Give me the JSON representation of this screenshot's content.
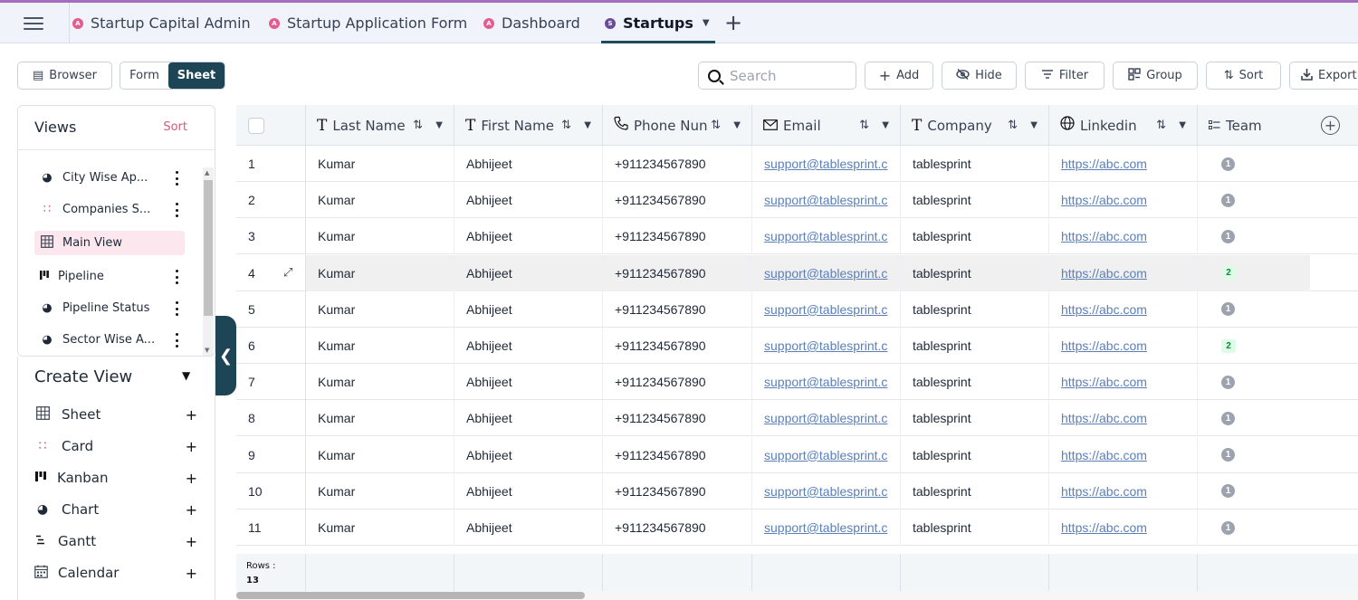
{
  "tabs": [
    {
      "label": "Startup Capital Admin",
      "badge": "A"
    },
    {
      "label": "Startup Application Form",
      "badge": "A"
    },
    {
      "label": "Dashboard",
      "badge": "A"
    },
    {
      "label": "Startups",
      "badge": "S",
      "active": true
    }
  ],
  "toolbar": {
    "browser_label": "Browser",
    "form_label": "Form",
    "sheet_label": "Sheet",
    "search_placeholder": "Search",
    "add_label": "Add",
    "hide_label": "Hide",
    "filter_label": "Filter",
    "group_label": "Group",
    "sort_label": "Sort",
    "export_label": "Export"
  },
  "views": {
    "title": "Views",
    "sort_label": "Sort",
    "items": [
      {
        "label": "City Wise Ap...",
        "icon": "pie-chart-icon"
      },
      {
        "label": "Companies S...",
        "icon": "card-grid-icon"
      },
      {
        "label": "Main View",
        "icon": "sheet-grid-icon",
        "selected": true
      },
      {
        "label": "Pipeline",
        "icon": "kanban-icon"
      },
      {
        "label": "Pipeline Status",
        "icon": "pie-chart-icon"
      },
      {
        "label": "Sector Wise A...",
        "icon": "pie-chart-icon"
      }
    ]
  },
  "create_view": {
    "title": "Create View",
    "items": [
      {
        "label": "Sheet",
        "icon": "sheet-grid-icon"
      },
      {
        "label": "Card",
        "icon": "card-grid-icon"
      },
      {
        "label": "Kanban",
        "icon": "kanban-icon"
      },
      {
        "label": "Chart",
        "icon": "pie-chart-icon"
      },
      {
        "label": "Gantt",
        "icon": "gantt-icon"
      },
      {
        "label": "Calendar",
        "icon": "calendar-icon"
      }
    ]
  },
  "table": {
    "columns": [
      "Last Name",
      "First Name",
      "Phone Nun",
      "Email",
      "Company",
      "Linkedin",
      "Team"
    ],
    "rows": [
      {
        "n": "1",
        "last": "Kumar",
        "first": "Abhijeet",
        "phone": "+911234567890",
        "email": "support@tablesprint.c",
        "company": "tablesprint",
        "linkedin": "https://abc.com",
        "team": "1"
      },
      {
        "n": "2",
        "last": "Kumar",
        "first": "Abhijeet",
        "phone": "+911234567890",
        "email": "support@tablesprint.c",
        "company": "tablesprint",
        "linkedin": "https://abc.com",
        "team": "1"
      },
      {
        "n": "3",
        "last": "Kumar",
        "first": "Abhijeet",
        "phone": "+911234567890",
        "email": "support@tablesprint.c",
        "company": "tablesprint",
        "linkedin": "https://abc.com",
        "team": "1"
      },
      {
        "n": "4",
        "last": "Kumar",
        "first": "Abhijeet",
        "phone": "+911234567890",
        "email": "support@tablesprint.c",
        "company": "tablesprint",
        "linkedin": "https://abc.com",
        "team": "2"
      },
      {
        "n": "5",
        "last": "Kumar",
        "first": "Abhijeet",
        "phone": "+911234567890",
        "email": "support@tablesprint.c",
        "company": "tablesprint",
        "linkedin": "https://abc.com",
        "team": "1"
      },
      {
        "n": "6",
        "last": "Kumar",
        "first": "Abhijeet",
        "phone": "+911234567890",
        "email": "support@tablesprint.c",
        "company": "tablesprint",
        "linkedin": "https://abc.com",
        "team": "2"
      },
      {
        "n": "7",
        "last": "Kumar",
        "first": "Abhijeet",
        "phone": "+911234567890",
        "email": "support@tablesprint.c",
        "company": "tablesprint",
        "linkedin": "https://abc.com",
        "team": "1"
      },
      {
        "n": "8",
        "last": "Kumar",
        "first": "Abhijeet",
        "phone": "+911234567890",
        "email": "support@tablesprint.c",
        "company": "tablesprint",
        "linkedin": "https://abc.com",
        "team": "1"
      },
      {
        "n": "9",
        "last": "Kumar",
        "first": "Abhijeet",
        "phone": "+911234567890",
        "email": "support@tablesprint.c",
        "company": "tablesprint",
        "linkedin": "https://abc.com",
        "team": "1"
      },
      {
        "n": "10",
        "last": "Kumar",
        "first": "Abhijeet",
        "phone": "+911234567890",
        "email": "support@tablesprint.c",
        "company": "tablesprint",
        "linkedin": "https://abc.com",
        "team": "1"
      },
      {
        "n": "11",
        "last": "Kumar",
        "first": "Abhijeet",
        "phone": "+911234567890",
        "email": "support@tablesprint.c",
        "company": "tablesprint",
        "linkedin": "https://abc.com",
        "team": "1"
      }
    ],
    "rows_label": "Rows :",
    "rows_count": "13"
  },
  "colors": {
    "accent_dark": "#1d4556",
    "view_sort_pink": "#d45a7c",
    "tab_badge_pink": "#e35d8f",
    "tab_badge_purple": "#6b4c9a",
    "link_blue": "#5b7fb8"
  }
}
